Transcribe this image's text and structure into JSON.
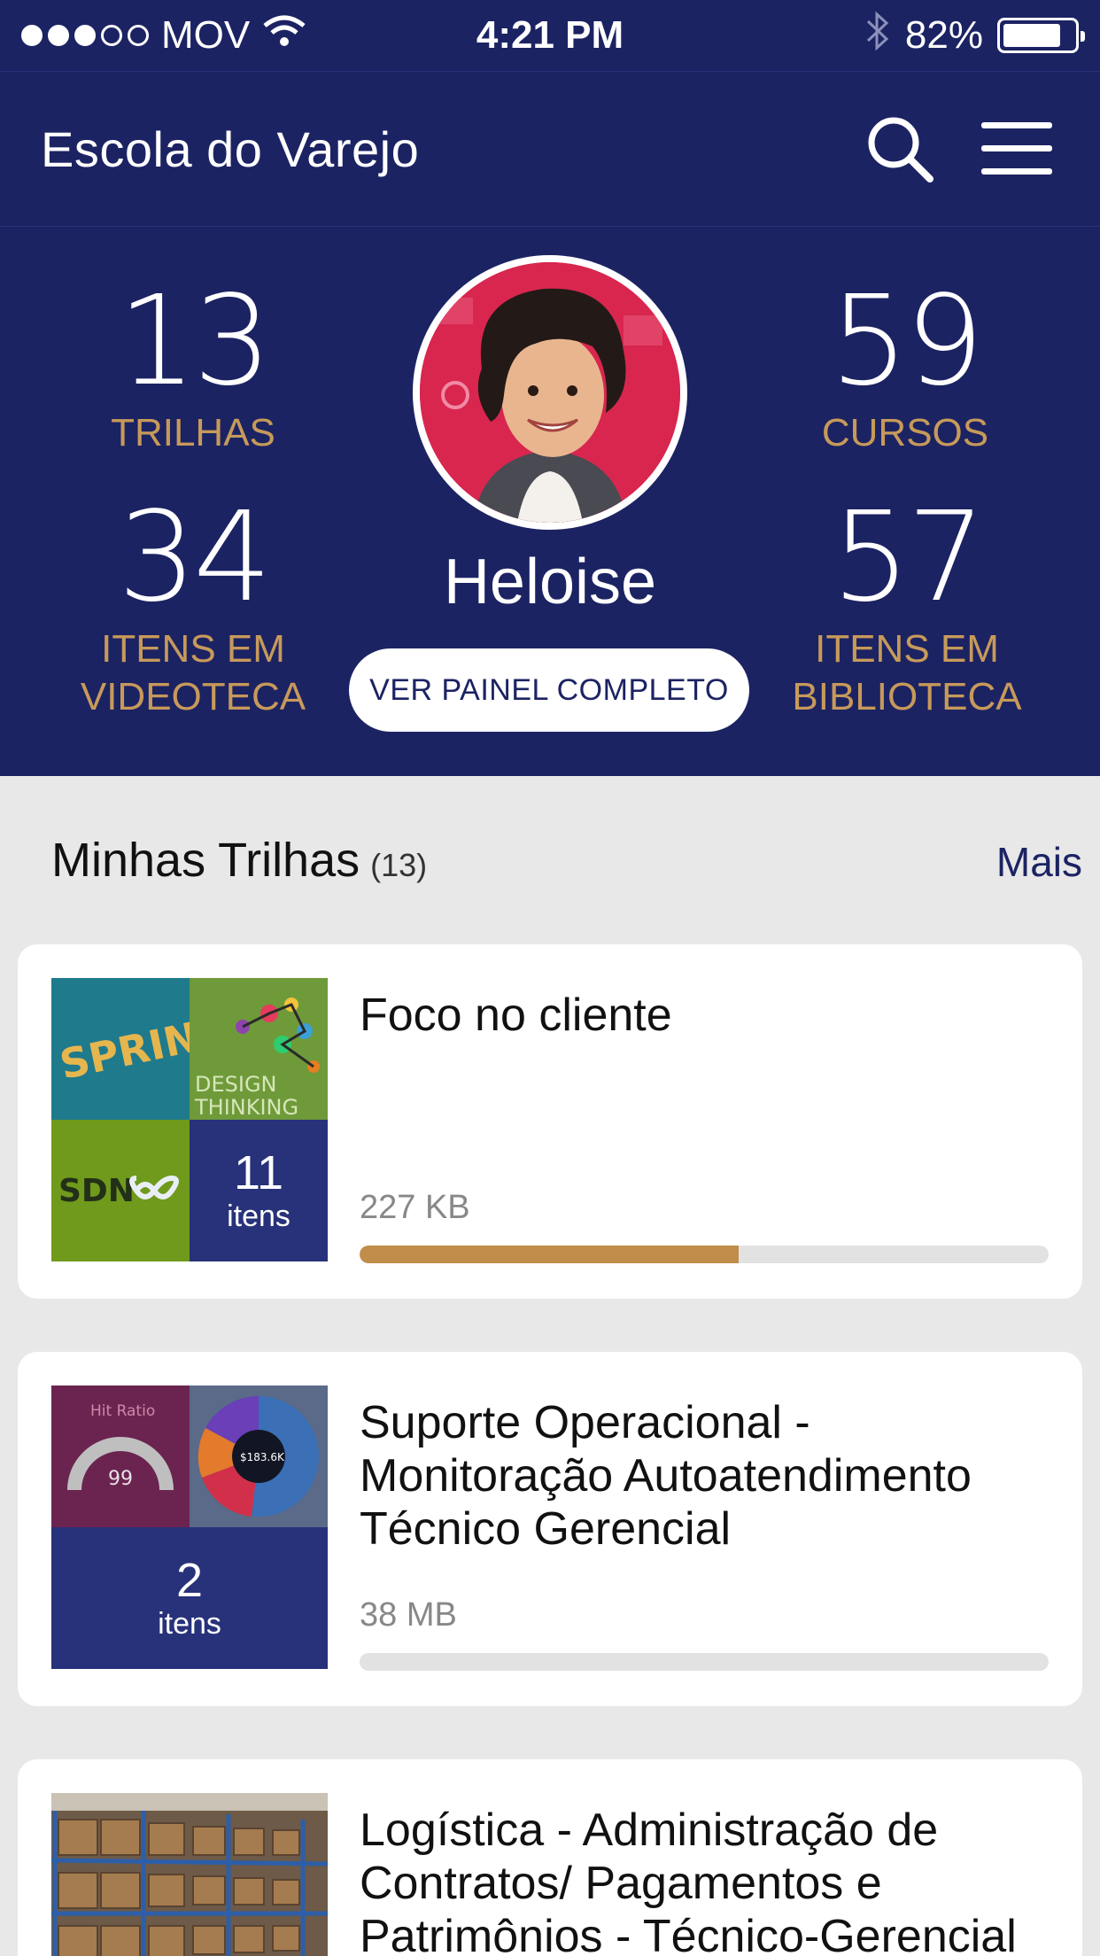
{
  "status_bar": {
    "carrier": "MOV",
    "time": "4:21 PM",
    "battery": "82%",
    "battery_level": 0.82
  },
  "header": {
    "title": "Escola do Varejo",
    "search_icon": "search-icon",
    "menu_icon": "hamburger-menu-icon"
  },
  "profile": {
    "name": "Heloise",
    "button_label": "VER PAINEL COMPLETO",
    "stats": [
      {
        "value": "13",
        "label": "TRILHAS"
      },
      {
        "value": "59",
        "label": "CURSOS"
      },
      {
        "value": "34",
        "label": "ITENS EM VIDEOTECA"
      },
      {
        "value": "57",
        "label": "ITENS EM BIBLIOTECA"
      }
    ]
  },
  "section": {
    "title": "Minhas Trilhas",
    "count": "(13)",
    "more": "Mais"
  },
  "cards": [
    {
      "title": "Foco no cliente",
      "size": "227 KB",
      "progress": 0.55,
      "count": "11",
      "count_label": "itens",
      "thumb_texts": {
        "sprint": "SPRINT",
        "design": "DESIGN",
        "thinking": "THINKING",
        "sdn": "SDN"
      }
    },
    {
      "title": "Suporte Operacional - Monitoração Autoatendimento Técnico Gerencial",
      "size": "38 MB",
      "progress": 0,
      "count": "2",
      "count_label": "itens",
      "thumb_texts": {
        "hit_ratio": "Hit Ratio",
        "gauge_value": "99",
        "pie_value": "$183.6K"
      }
    },
    {
      "title": "Logística - Administração de Contratos/ Pagamentos e Patrimônios - Técnico-Gerencial"
    }
  ],
  "colors": {
    "primary": "#1c2363",
    "accent": "#c79a5a",
    "progress": "#c18d4a"
  }
}
